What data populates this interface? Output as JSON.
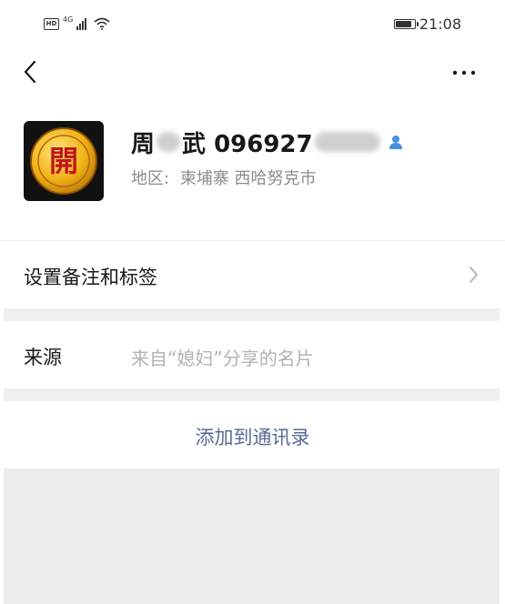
{
  "status_bar": {
    "hd": "HD",
    "network": "4G",
    "time": "21:08",
    "battery_level": 0.9
  },
  "nav": {
    "back_icon": "chevron-left-icon",
    "more_icon": "ellipsis-icon"
  },
  "profile": {
    "avatar_char": "開",
    "name_part1": "周",
    "name_part2": "武 096927",
    "region_label": "地区:",
    "region_value": "柬埔寨  西哈努克市",
    "badge_icon": "person-icon",
    "badge_color": "#4a90e2"
  },
  "remark_row": {
    "label": "设置备注和标签"
  },
  "source_row": {
    "label": "来源",
    "value": "来自“媳妇”分享的名片"
  },
  "action": {
    "add_label": "添加到通讯录",
    "color": "#576b95"
  }
}
